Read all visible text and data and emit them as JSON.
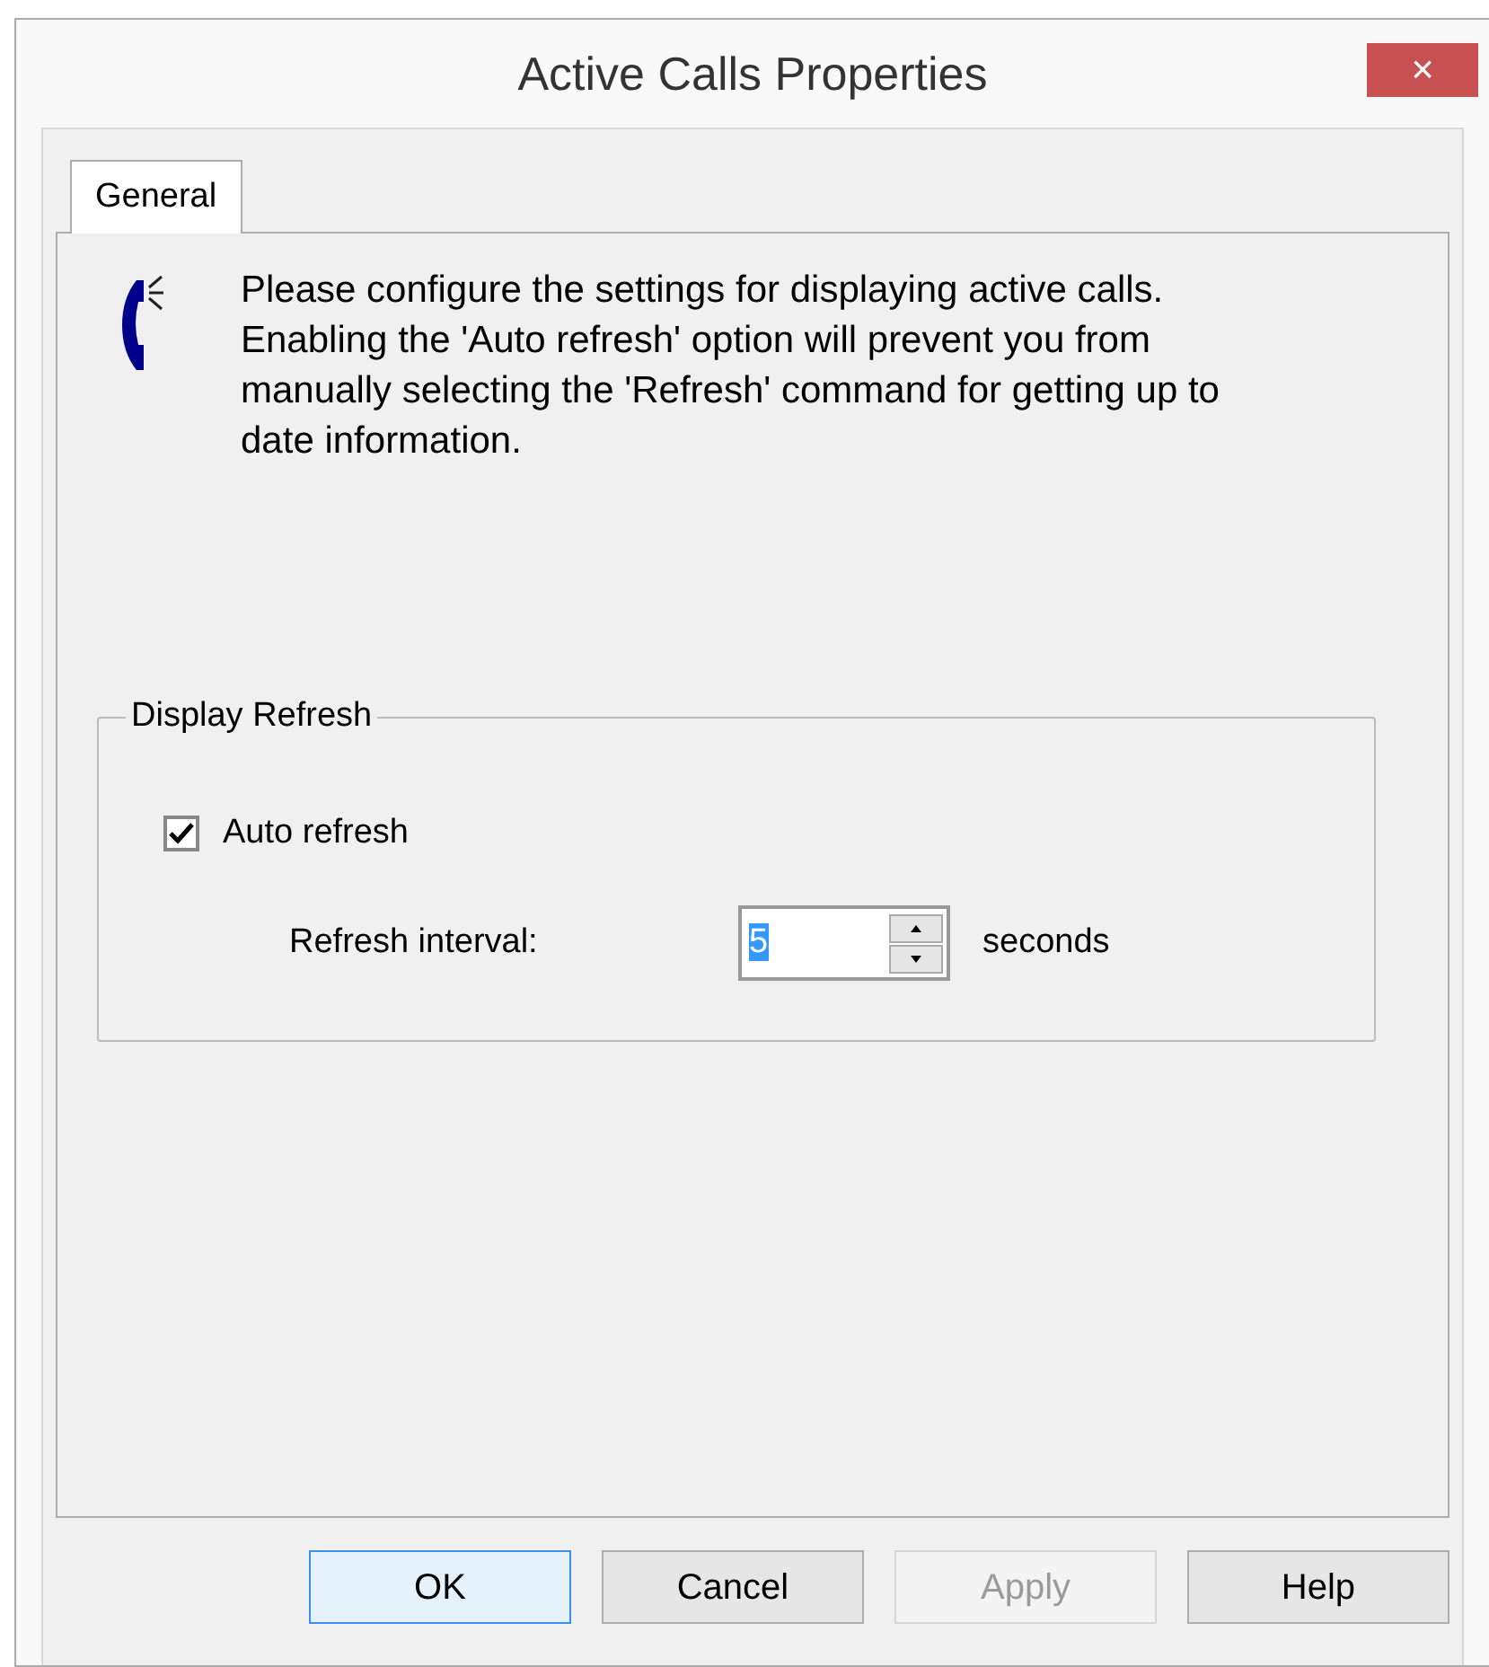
{
  "window": {
    "title": "Active Calls Properties",
    "close": "×"
  },
  "tabs": [
    {
      "label": "General",
      "selected": true
    }
  ],
  "description": "Please configure the settings for displaying active calls. Enabling the 'Auto refresh' option will prevent you from manually selecting the 'Refresh' command for getting up to date information.",
  "group": {
    "title": "Display Refresh",
    "auto_refresh": {
      "label": "Auto refresh",
      "checked": true
    },
    "interval": {
      "label": "Refresh interval:",
      "value": "5",
      "unit": "seconds"
    }
  },
  "buttons": [
    {
      "label": "OK",
      "default": true,
      "disabled": false
    },
    {
      "label": "Cancel",
      "default": false,
      "disabled": false
    },
    {
      "label": "Apply",
      "default": false,
      "disabled": true
    },
    {
      "label": "Help",
      "default": false,
      "disabled": false
    }
  ]
}
